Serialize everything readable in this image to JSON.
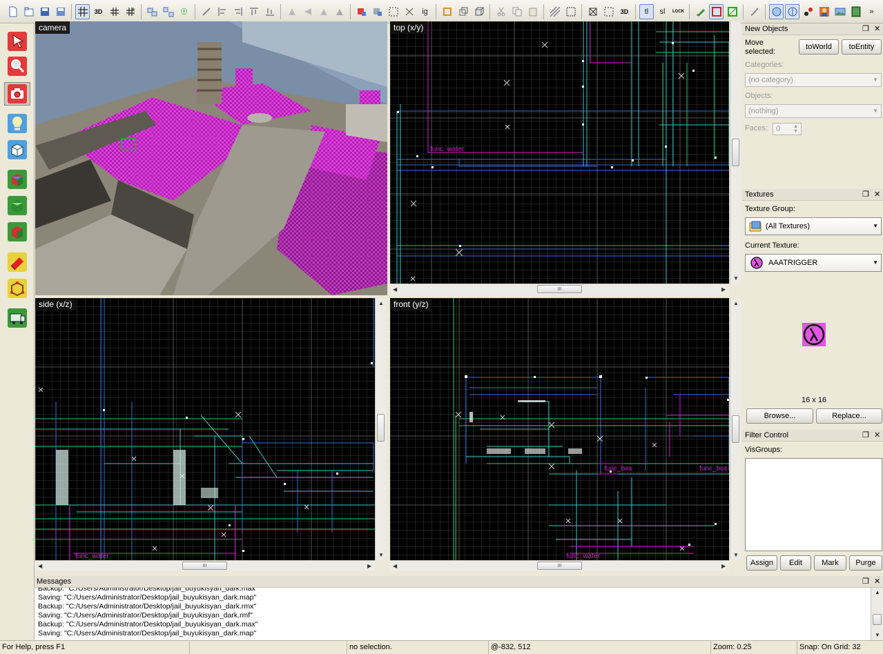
{
  "toolbar": {
    "icons": [
      "new-file",
      "open-file",
      "save-file",
      "save-as",
      "grid-toggle",
      "3d-grid",
      "smaller-grid",
      "larger-grid",
      "carve",
      "hollow",
      "group",
      "ungroup",
      "entity-help",
      "cut",
      "copy",
      "paste",
      "check-problems",
      "map-properties",
      "texture-lock",
      "transform",
      "tools-options",
      "run-map",
      "camera-view",
      "hide-selected"
    ],
    "text_buttons": {
      "tl": "tl",
      "sl": "sl",
      "ig": "ig",
      "lock": "LOCK",
      "more": "»"
    }
  },
  "left_tools": [
    "selection-tool",
    "magnify-tool",
    "camera-tool",
    "entity-tool",
    "block-tool",
    "texture-application-tool",
    "apply-current-texture-tool",
    "decal-tool",
    "clipping-tool",
    "vertex-tool",
    "path-tool"
  ],
  "viewports": {
    "camera": {
      "label": "camera"
    },
    "top": {
      "label": "top (x/y)",
      "entity_label": "func_water"
    },
    "side": {
      "label": "side (x/z)",
      "entity_label": "func_water"
    },
    "front": {
      "label": "front (y/z)",
      "entity_label_1": "func_box",
      "entity_label_2": "func_water",
      "entity_label_3": "func_box"
    }
  },
  "scroll_thumb_glyph": "III",
  "new_objects": {
    "title": "New Objects",
    "move_selected": "Move",
    "move_selected_2": "selected:",
    "to_world": "toWorld",
    "to_entity": "toEntity",
    "categories_label": "Categories:",
    "categories_value": "(no category)",
    "objects_label": "Objects:",
    "objects_value": "(nothing)",
    "faces_label": "Faces:",
    "faces_value": "0"
  },
  "textures": {
    "title": "Textures",
    "group_label": "Texture Group:",
    "group_value": "(All Textures)",
    "current_label": "Current Texture:",
    "current_value": "AAATRIGGER",
    "size": "16 x 16",
    "browse": "Browse...",
    "replace": "Replace..."
  },
  "filter_control": {
    "title": "Filter Control",
    "visgroups_label": "VisGroups:",
    "assign": "Assign",
    "edit": "Edit",
    "mark": "Mark",
    "purge": "Purge"
  },
  "panel_controls": {
    "restore": "❐",
    "close": "✕"
  },
  "messages": {
    "title": "Messages",
    "lines": [
      "Backup: \"C:/Users/Administrator/Desktop/jail_buyukisyan_dark.max\"",
      "Saving: \"C:/Users/Administrator/Desktop/jail_buyukisyan_dark.map\"",
      "Backup: \"C:/Users/Administrator/Desktop/jail_buyukisyan_dark.rmx\"",
      "Saving: \"C:/Users/Administrator/Desktop/jail_buyukisyan_dark.rmf\"",
      "Backup: \"C:/Users/Administrator/Desktop/jail_buyukisyan_dark.max\"",
      "Saving: \"C:/Users/Administrator/Desktop/jail_buyukisyan_dark.map\""
    ]
  },
  "status": {
    "help": "For Help, press F1",
    "selection": "no selection.",
    "coords": "@-832, 512",
    "zoom": "Zoom: 0.25",
    "snap": "Snap: On Grid: 32"
  },
  "colors": {
    "grid_minor": "#3a3a3a",
    "grid_major": "#606060",
    "brush_cyan": "#3ec7c7",
    "brush_green": "#36c97a",
    "brush_blue": "#3b6fd8",
    "entity_magenta": "#d41fd4"
  }
}
